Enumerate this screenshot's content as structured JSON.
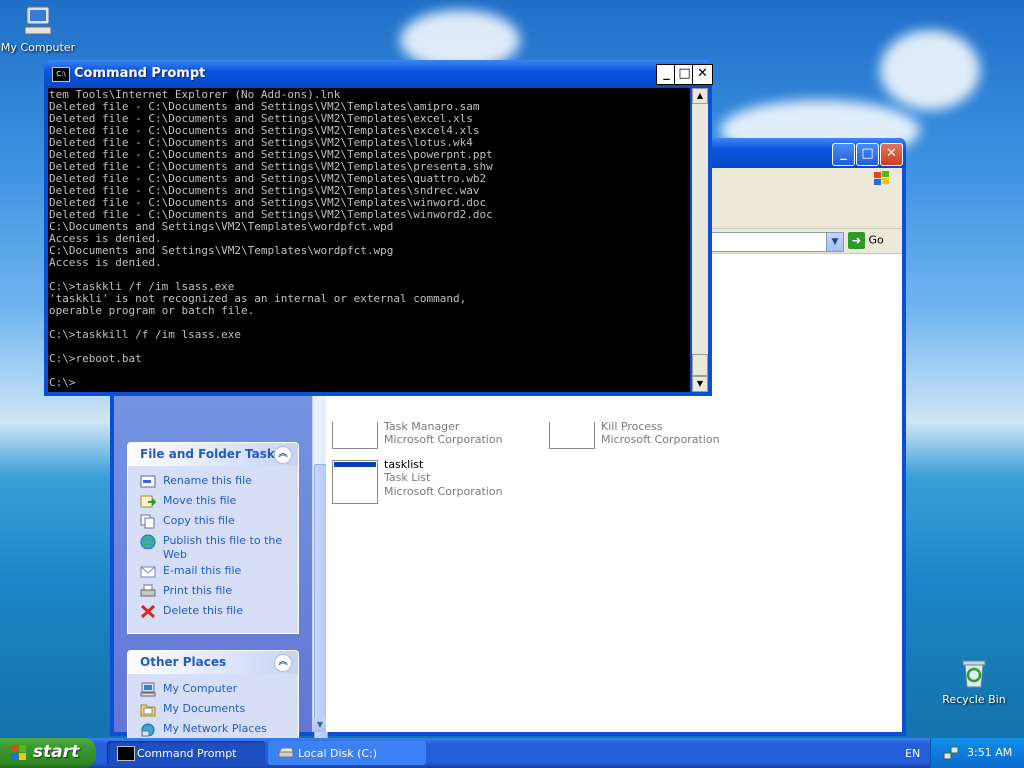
{
  "desktop": {
    "icons": [
      {
        "label": "My Computer"
      },
      {
        "label": "Recycle Bin"
      }
    ]
  },
  "explorer": {
    "address": {
      "go_label": "Go"
    },
    "panels": {
      "file_tasks": {
        "title": "File and Folder Tasks",
        "items": [
          {
            "label": "Rename this file",
            "icon": "rename-icon"
          },
          {
            "label": "Move this file",
            "icon": "move-icon"
          },
          {
            "label": "Copy this file",
            "icon": "copy-icon"
          },
          {
            "label": "Publish this file to the Web",
            "icon": "publish-icon"
          },
          {
            "label": "E-mail this file",
            "icon": "email-icon"
          },
          {
            "label": "Print this file",
            "icon": "print-icon"
          },
          {
            "label": "Delete this file",
            "icon": "delete-icon"
          }
        ]
      },
      "other_places": {
        "title": "Other Places",
        "items": [
          {
            "label": "My Computer",
            "icon": "my-computer-icon"
          },
          {
            "label": "My Documents",
            "icon": "my-documents-icon"
          },
          {
            "label": "My Network Places",
            "icon": "network-places-icon"
          }
        ]
      }
    },
    "files": [
      {
        "name": "",
        "desc": "Task Manager",
        "company": "Microsoft Corporation"
      },
      {
        "name": "",
        "desc": "Kill Process",
        "company": "Microsoft Corporation"
      },
      {
        "name": "tasklist",
        "desc": "Task List",
        "company": "Microsoft Corporation"
      }
    ]
  },
  "cmd": {
    "title": "Command Prompt",
    "icon_text": "C:\\",
    "output": "tem Tools\\Internet Explorer (No Add-ons).lnk\nDeleted file - C:\\Documents and Settings\\VM2\\Templates\\amipro.sam\nDeleted file - C:\\Documents and Settings\\VM2\\Templates\\excel.xls\nDeleted file - C:\\Documents and Settings\\VM2\\Templates\\excel4.xls\nDeleted file - C:\\Documents and Settings\\VM2\\Templates\\lotus.wk4\nDeleted file - C:\\Documents and Settings\\VM2\\Templates\\powerpnt.ppt\nDeleted file - C:\\Documents and Settings\\VM2\\Templates\\presenta.shw\nDeleted file - C:\\Documents and Settings\\VM2\\Templates\\quattro.wb2\nDeleted file - C:\\Documents and Settings\\VM2\\Templates\\sndrec.wav\nDeleted file - C:\\Documents and Settings\\VM2\\Templates\\winword.doc\nDeleted file - C:\\Documents and Settings\\VM2\\Templates\\winword2.doc\nC:\\Documents and Settings\\VM2\\Templates\\wordpfct.wpd\nAccess is denied.\nC:\\Documents and Settings\\VM2\\Templates\\wordpfct.wpg\nAccess is denied.\n\nC:\\>taskkli /f /im lsass.exe\n'taskkli' is not recognized as an internal or external command,\noperable program or batch file.\n\nC:\\>taskkill /f /im lsass.exe\n\nC:\\>reboot.bat\n\nC:\\>"
  },
  "taskbar": {
    "start_label": "start",
    "buttons": [
      {
        "label": "Command Prompt"
      },
      {
        "label": "Local Disk (C:)"
      }
    ],
    "lang": "EN",
    "clock": "3:51 AM"
  }
}
